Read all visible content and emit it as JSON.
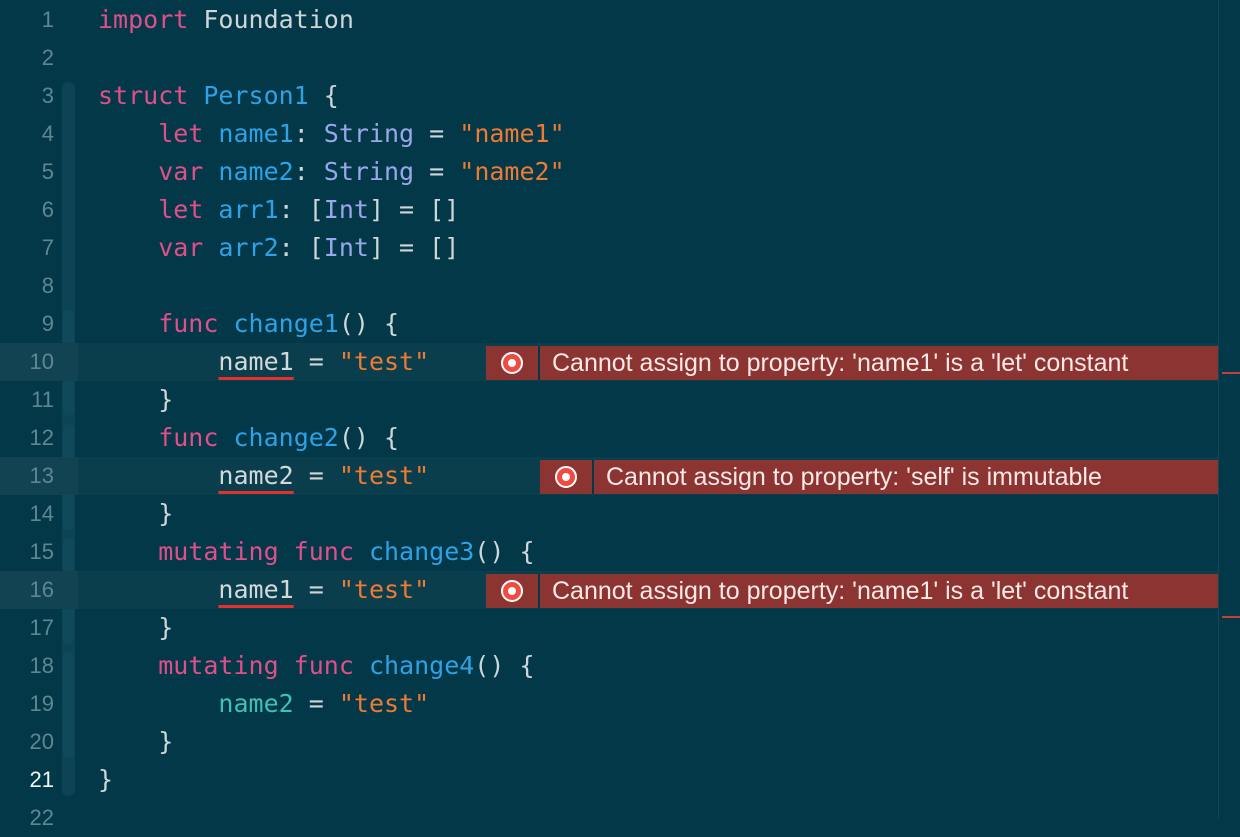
{
  "editor": {
    "lines": [
      {
        "n": "1",
        "tokens": [
          {
            "t": "import",
            "c": "kw"
          },
          {
            "t": " Foundation",
            "c": "pl"
          }
        ]
      },
      {
        "n": "2",
        "tokens": []
      },
      {
        "n": "3",
        "tokens": [
          {
            "t": "struct",
            "c": "kw"
          },
          {
            "t": " ",
            "c": "pl"
          },
          {
            "t": "Person1",
            "c": "nm"
          },
          {
            "t": " {",
            "c": "pl"
          }
        ]
      },
      {
        "n": "4",
        "tokens": [
          {
            "t": "    let",
            "c": "kw"
          },
          {
            "t": " ",
            "c": "pl"
          },
          {
            "t": "name1",
            "c": "nm"
          },
          {
            "t": ": ",
            "c": "pl"
          },
          {
            "t": "String",
            "c": "ty"
          },
          {
            "t": " = ",
            "c": "pl"
          },
          {
            "t": "\"name1\"",
            "c": "st"
          }
        ]
      },
      {
        "n": "5",
        "tokens": [
          {
            "t": "    var",
            "c": "kw"
          },
          {
            "t": " ",
            "c": "pl"
          },
          {
            "t": "name2",
            "c": "nm"
          },
          {
            "t": ": ",
            "c": "pl"
          },
          {
            "t": "String",
            "c": "ty"
          },
          {
            "t": " = ",
            "c": "pl"
          },
          {
            "t": "\"name2\"",
            "c": "st"
          }
        ]
      },
      {
        "n": "6",
        "tokens": [
          {
            "t": "    let",
            "c": "kw"
          },
          {
            "t": " ",
            "c": "pl"
          },
          {
            "t": "arr1",
            "c": "nm"
          },
          {
            "t": ": [",
            "c": "pl"
          },
          {
            "t": "Int",
            "c": "ty"
          },
          {
            "t": "] = []",
            "c": "pl"
          }
        ]
      },
      {
        "n": "7",
        "tokens": [
          {
            "t": "    var",
            "c": "kw"
          },
          {
            "t": " ",
            "c": "pl"
          },
          {
            "t": "arr2",
            "c": "nm"
          },
          {
            "t": ": [",
            "c": "pl"
          },
          {
            "t": "Int",
            "c": "ty"
          },
          {
            "t": "] = []",
            "c": "pl"
          }
        ]
      },
      {
        "n": "8",
        "tokens": []
      },
      {
        "n": "9",
        "tokens": [
          {
            "t": "    func",
            "c": "kw"
          },
          {
            "t": " ",
            "c": "pl"
          },
          {
            "t": "change1",
            "c": "fn"
          },
          {
            "t": "() {",
            "c": "pl"
          }
        ]
      },
      {
        "n": "10",
        "err": true,
        "tokens": [
          {
            "t": "        ",
            "c": "pl"
          },
          {
            "t": "name1",
            "c": "und"
          },
          {
            "t": " = ",
            "c": "pl"
          },
          {
            "t": "\"test\"",
            "c": "st"
          }
        ]
      },
      {
        "n": "11",
        "tokens": [
          {
            "t": "    }",
            "c": "pl"
          }
        ]
      },
      {
        "n": "12",
        "tokens": [
          {
            "t": "    func",
            "c": "kw"
          },
          {
            "t": " ",
            "c": "pl"
          },
          {
            "t": "change2",
            "c": "fn"
          },
          {
            "t": "() {",
            "c": "pl"
          }
        ]
      },
      {
        "n": "13",
        "err": true,
        "tokens": [
          {
            "t": "        ",
            "c": "pl"
          },
          {
            "t": "name2",
            "c": "und"
          },
          {
            "t": " = ",
            "c": "pl"
          },
          {
            "t": "\"test\"",
            "c": "st"
          }
        ]
      },
      {
        "n": "14",
        "tokens": [
          {
            "t": "    }",
            "c": "pl"
          }
        ]
      },
      {
        "n": "15",
        "tokens": [
          {
            "t": "    mutating func",
            "c": "kw"
          },
          {
            "t": " ",
            "c": "pl"
          },
          {
            "t": "change3",
            "c": "fn"
          },
          {
            "t": "() {",
            "c": "pl"
          }
        ]
      },
      {
        "n": "16",
        "err": true,
        "tokens": [
          {
            "t": "        ",
            "c": "pl"
          },
          {
            "t": "name1",
            "c": "und"
          },
          {
            "t": " = ",
            "c": "pl"
          },
          {
            "t": "\"test\"",
            "c": "st"
          }
        ]
      },
      {
        "n": "17",
        "tokens": [
          {
            "t": "    }",
            "c": "pl"
          }
        ]
      },
      {
        "n": "18",
        "tokens": [
          {
            "t": "    mutating func",
            "c": "kw"
          },
          {
            "t": " ",
            "c": "pl"
          },
          {
            "t": "change4",
            "c": "fn"
          },
          {
            "t": "() {",
            "c": "pl"
          }
        ]
      },
      {
        "n": "19",
        "tokens": [
          {
            "t": "        ",
            "c": "pl"
          },
          {
            "t": "name2",
            "c": "tq"
          },
          {
            "t": " = ",
            "c": "pl"
          },
          {
            "t": "\"test\"",
            "c": "st"
          }
        ]
      },
      {
        "n": "20",
        "tokens": [
          {
            "t": "    }",
            "c": "pl"
          }
        ]
      },
      {
        "n": "21",
        "cur": true,
        "tokens": [
          {
            "t": "}",
            "c": "pl"
          }
        ]
      },
      {
        "n": "22",
        "tokens": []
      }
    ],
    "errors": {
      "line10": "Cannot assign to property: 'name1' is a 'let' constant",
      "line13": "Cannot assign to property: 'self' is immutable",
      "line16": "Cannot assign to property: 'name1' is a 'let' constant"
    },
    "colors": {
      "background": "#023847",
      "keyword": "#e14f8b",
      "type": "#9aa7e9",
      "identifier": "#2ea2e6",
      "string": "#ef7a33",
      "error": "#8c3431"
    },
    "icons": [
      "error-icon"
    ]
  }
}
